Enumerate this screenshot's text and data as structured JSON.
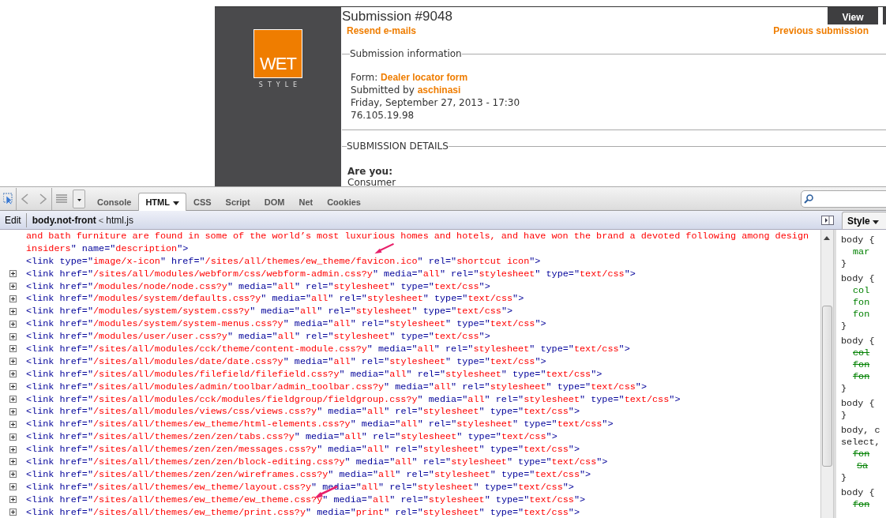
{
  "page": {
    "logo": {
      "word": "WET",
      "subword": "STYLE"
    },
    "title": "Submission #9048",
    "view_tab": {
      "label": "View",
      "selected": true
    },
    "links": [
      "Resend e-mails",
      "Previous submission"
    ],
    "info": {
      "legend": "Submission information",
      "form_label": "Form:",
      "form_link": "Dealer locator form",
      "submitted_label": "Submitted by",
      "user_link": "aschinasi",
      "date": "Friday, September 27, 2013 - 17:30",
      "ip": "76.105.19.98"
    },
    "details": {
      "legend": "SUBMISSION DETAILS",
      "question": "Are you:",
      "answer": "Consumer"
    }
  },
  "devtools": {
    "tabs": [
      {
        "label": "Console",
        "selected": false,
        "menu": false
      },
      {
        "label": "HTML",
        "selected": true,
        "menu": true
      },
      {
        "label": "CSS",
        "selected": false,
        "menu": false
      },
      {
        "label": "Script",
        "selected": false,
        "menu": false
      },
      {
        "label": "DOM",
        "selected": false,
        "menu": false
      },
      {
        "label": "Net",
        "selected": false,
        "menu": false
      },
      {
        "label": "Cookies",
        "selected": false,
        "menu": false
      }
    ],
    "breadcrumb": {
      "edit": "Edit",
      "current": "body.not-front",
      "separator": "<",
      "parent": "html.js"
    },
    "side_tab": "Style",
    "code_lines": [
      {
        "expandable": false,
        "starts_in_value": true,
        "text": "and bath furniture are found in some of the world’s most luxurious homes and hotels, and have won the brand a devoted following among design"
      },
      {
        "expandable": false,
        "starts_in_value": true,
        "text": "insiders\" name=\"description\">"
      },
      {
        "expandable": false,
        "starts_in_value": false,
        "text": "<link type=\"image/x-icon\" href=\"/sites/all/themes/ew_theme/favicon.ico\" rel=\"shortcut icon\">"
      },
      {
        "expandable": true,
        "starts_in_value": false,
        "text": "<link href=\"/sites/all/modules/webform/css/webform-admin.css?y\" media=\"all\" rel=\"stylesheet\" type=\"text/css\">"
      },
      {
        "expandable": true,
        "starts_in_value": false,
        "text": "<link href=\"/modules/node/node.css?y\" media=\"all\" rel=\"stylesheet\" type=\"text/css\">"
      },
      {
        "expandable": true,
        "starts_in_value": false,
        "text": "<link href=\"/modules/system/defaults.css?y\" media=\"all\" rel=\"stylesheet\" type=\"text/css\">"
      },
      {
        "expandable": true,
        "starts_in_value": false,
        "text": "<link href=\"/modules/system/system.css?y\" media=\"all\" rel=\"stylesheet\" type=\"text/css\">"
      },
      {
        "expandable": true,
        "starts_in_value": false,
        "text": "<link href=\"/modules/system/system-menus.css?y\" media=\"all\" rel=\"stylesheet\" type=\"text/css\">"
      },
      {
        "expandable": true,
        "starts_in_value": false,
        "text": "<link href=\"/modules/user/user.css?y\" media=\"all\" rel=\"stylesheet\" type=\"text/css\">"
      },
      {
        "expandable": true,
        "starts_in_value": false,
        "text": "<link href=\"/sites/all/modules/cck/theme/content-module.css?y\" media=\"all\" rel=\"stylesheet\" type=\"text/css\">"
      },
      {
        "expandable": true,
        "starts_in_value": false,
        "text": "<link href=\"/sites/all/modules/date/date.css?y\" media=\"all\" rel=\"stylesheet\" type=\"text/css\">"
      },
      {
        "expandable": true,
        "starts_in_value": false,
        "text": "<link href=\"/sites/all/modules/filefield/filefield.css?y\" media=\"all\" rel=\"stylesheet\" type=\"text/css\">"
      },
      {
        "expandable": true,
        "starts_in_value": false,
        "text": "<link href=\"/sites/all/modules/admin/toolbar/admin_toolbar.css?y\" media=\"all\" rel=\"stylesheet\" type=\"text/css\">"
      },
      {
        "expandable": true,
        "starts_in_value": false,
        "text": "<link href=\"/sites/all/modules/cck/modules/fieldgroup/fieldgroup.css?y\" media=\"all\" rel=\"stylesheet\" type=\"text/css\">"
      },
      {
        "expandable": true,
        "starts_in_value": false,
        "text": "<link href=\"/sites/all/modules/views/css/views.css?y\" media=\"all\" rel=\"stylesheet\" type=\"text/css\">"
      },
      {
        "expandable": true,
        "starts_in_value": false,
        "text": "<link href=\"/sites/all/themes/ew_theme/html-elements.css?y\" media=\"all\" rel=\"stylesheet\" type=\"text/css\">"
      },
      {
        "expandable": true,
        "starts_in_value": false,
        "text": "<link href=\"/sites/all/themes/zen/zen/tabs.css?y\" media=\"all\" rel=\"stylesheet\" type=\"text/css\">"
      },
      {
        "expandable": true,
        "starts_in_value": false,
        "text": "<link href=\"/sites/all/themes/zen/zen/messages.css?y\" media=\"all\" rel=\"stylesheet\" type=\"text/css\">"
      },
      {
        "expandable": true,
        "starts_in_value": false,
        "text": "<link href=\"/sites/all/themes/zen/zen/block-editing.css?y\" media=\"all\" rel=\"stylesheet\" type=\"text/css\">"
      },
      {
        "expandable": true,
        "starts_in_value": false,
        "text": "<link href=\"/sites/all/themes/zen/zen/wireframes.css?y\" media=\"all\" rel=\"stylesheet\" type=\"text/css\">"
      },
      {
        "expandable": true,
        "starts_in_value": false,
        "text": "<link href=\"/sites/all/themes/ew_theme/layout.css?y\" media=\"all\" rel=\"stylesheet\" type=\"text/css\">"
      },
      {
        "expandable": true,
        "starts_in_value": false,
        "text": "<link href=\"/sites/all/themes/ew_theme/ew_theme.css?y\" media=\"all\" rel=\"stylesheet\" type=\"text/css\">"
      },
      {
        "expandable": true,
        "starts_in_value": false,
        "text": "<link href=\"/sites/all/themes/ew_theme/print.css?y\" media=\"print\" rel=\"stylesheet\" type=\"text/css\">"
      }
    ],
    "style_rules": [
      {
        "selectors": [
          "body {"
        ],
        "properties": [
          {
            "text": "mar",
            "struck": false
          }
        ],
        "close": "}"
      },
      {
        "selectors": [
          "body {"
        ],
        "properties": [
          {
            "text": "col",
            "struck": false
          },
          {
            "text": "fon",
            "struck": false
          },
          {
            "text": "fon",
            "struck": false
          }
        ],
        "close": "}"
      },
      {
        "selectors": [
          "body {"
        ],
        "properties": [
          {
            "text": "col",
            "struck": true
          },
          {
            "text": "fon",
            "struck": true
          },
          {
            "text": "fon",
            "struck": true
          }
        ],
        "close": "}"
      },
      {
        "selectors": [
          "body {"
        ],
        "close": "}"
      },
      {
        "selectors": [
          "body, c",
          "select,"
        ],
        "properties": [
          {
            "text": "fon",
            "struck": true
          },
          {
            "text": "Sa",
            "struck": true
          }
        ],
        "close": "}"
      },
      {
        "selectors": [
          "body {"
        ],
        "properties": [
          {
            "text": "fon",
            "struck": true
          }
        ]
      }
    ]
  }
}
